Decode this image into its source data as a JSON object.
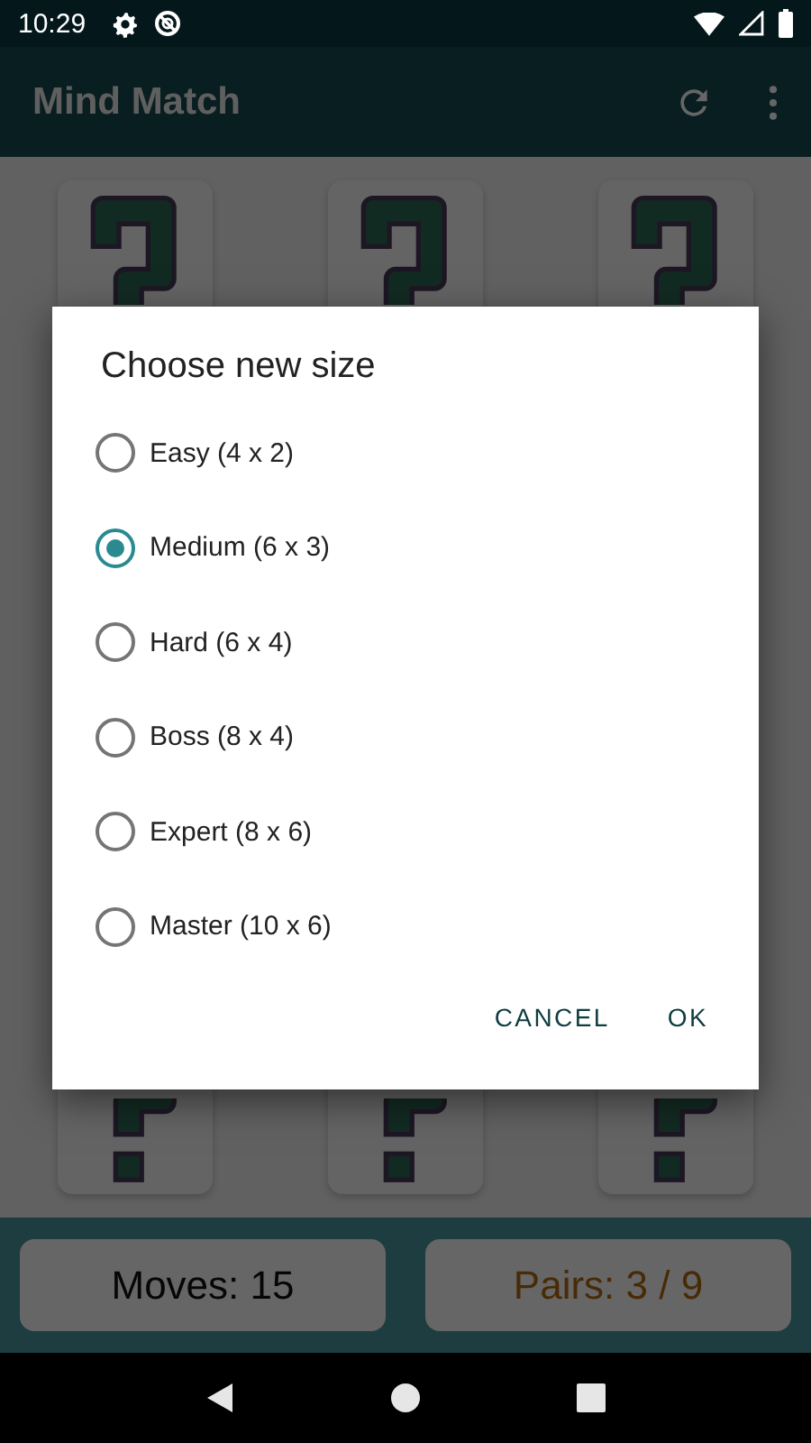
{
  "status_bar": {
    "time": "10:29"
  },
  "app_bar": {
    "title": "Mind Match"
  },
  "dialog": {
    "title": "Choose new size",
    "options": [
      {
        "label": "Easy (4 x 2)",
        "selected": false
      },
      {
        "label": "Medium (6 x 3)",
        "selected": true
      },
      {
        "label": "Hard (6 x 4)",
        "selected": false
      },
      {
        "label": "Boss (8 x 4)",
        "selected": false
      },
      {
        "label": "Expert (8 x 6)",
        "selected": false
      },
      {
        "label": "Master (10 x 6)",
        "selected": false
      }
    ],
    "buttons": [
      "CANCEL",
      "OK"
    ]
  },
  "footer": {
    "moves": "Moves: 15",
    "pairs": "Pairs: 3 / 9"
  }
}
